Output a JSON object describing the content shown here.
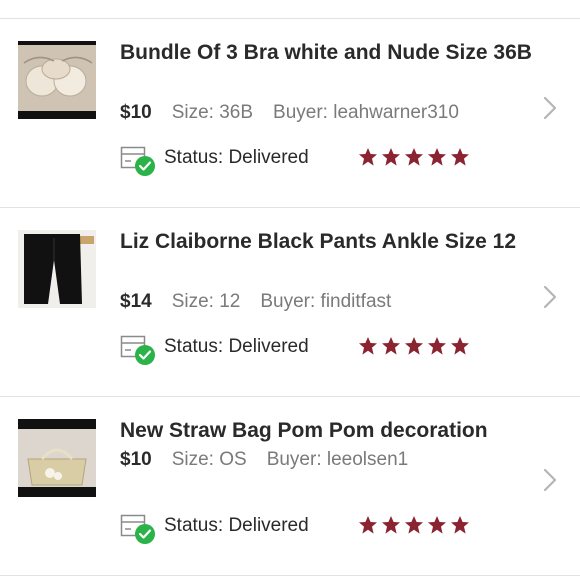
{
  "status_label": "Status:",
  "colors": {
    "star": "#8b2431",
    "check": "#2bb34a",
    "muted": "#7a7a7a",
    "divider": "#e2e2e2"
  },
  "orders": [
    {
      "title": "Bundle Of 3 Bra white and Nude Size 36B",
      "price": "$10",
      "size": "Size: 36B",
      "buyer": "Buyer: leahwarner310",
      "status": "Delivered",
      "rating": 5,
      "thumb_icon": "bra-photo"
    },
    {
      "title": "Liz Claiborne Black Pants Ankle Size 12",
      "price": "$14",
      "size": "Size: 12",
      "buyer": "Buyer: finditfast",
      "status": "Delivered",
      "rating": 5,
      "thumb_icon": "black-pants-photo"
    },
    {
      "title": "New Straw Bag Pom Pom decoration",
      "price": "$10",
      "size": "Size: OS",
      "buyer": "Buyer: leeolsen1",
      "status": "Delivered",
      "rating": 5,
      "thumb_icon": "straw-bag-photo"
    }
  ]
}
